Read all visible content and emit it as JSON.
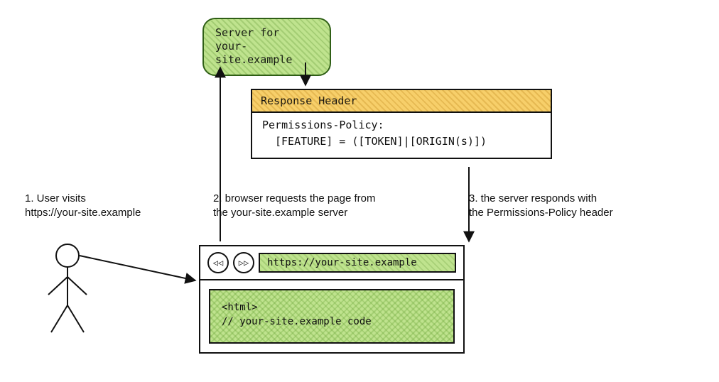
{
  "server": {
    "line1": "Server for",
    "line2": "your-site.example"
  },
  "response": {
    "header_label": "Response Header",
    "body_line1": "Permissions-Policy:",
    "body_line2": "[FEATURE] = ([TOKEN]|[ORIGIN(s)])"
  },
  "steps": {
    "s1": "1. User visits\n   https://your-site.example",
    "s2": "2. browser requests the page from\n   the your-site.example server",
    "s3": "3. the server responds with\n   the Permissions-Policy header"
  },
  "browser": {
    "back_glyph": "◁◁",
    "fwd_glyph": "▷▷",
    "url": "https://your-site.example",
    "code_line1": "<html>",
    "code_line2": "// your-site.example code"
  }
}
